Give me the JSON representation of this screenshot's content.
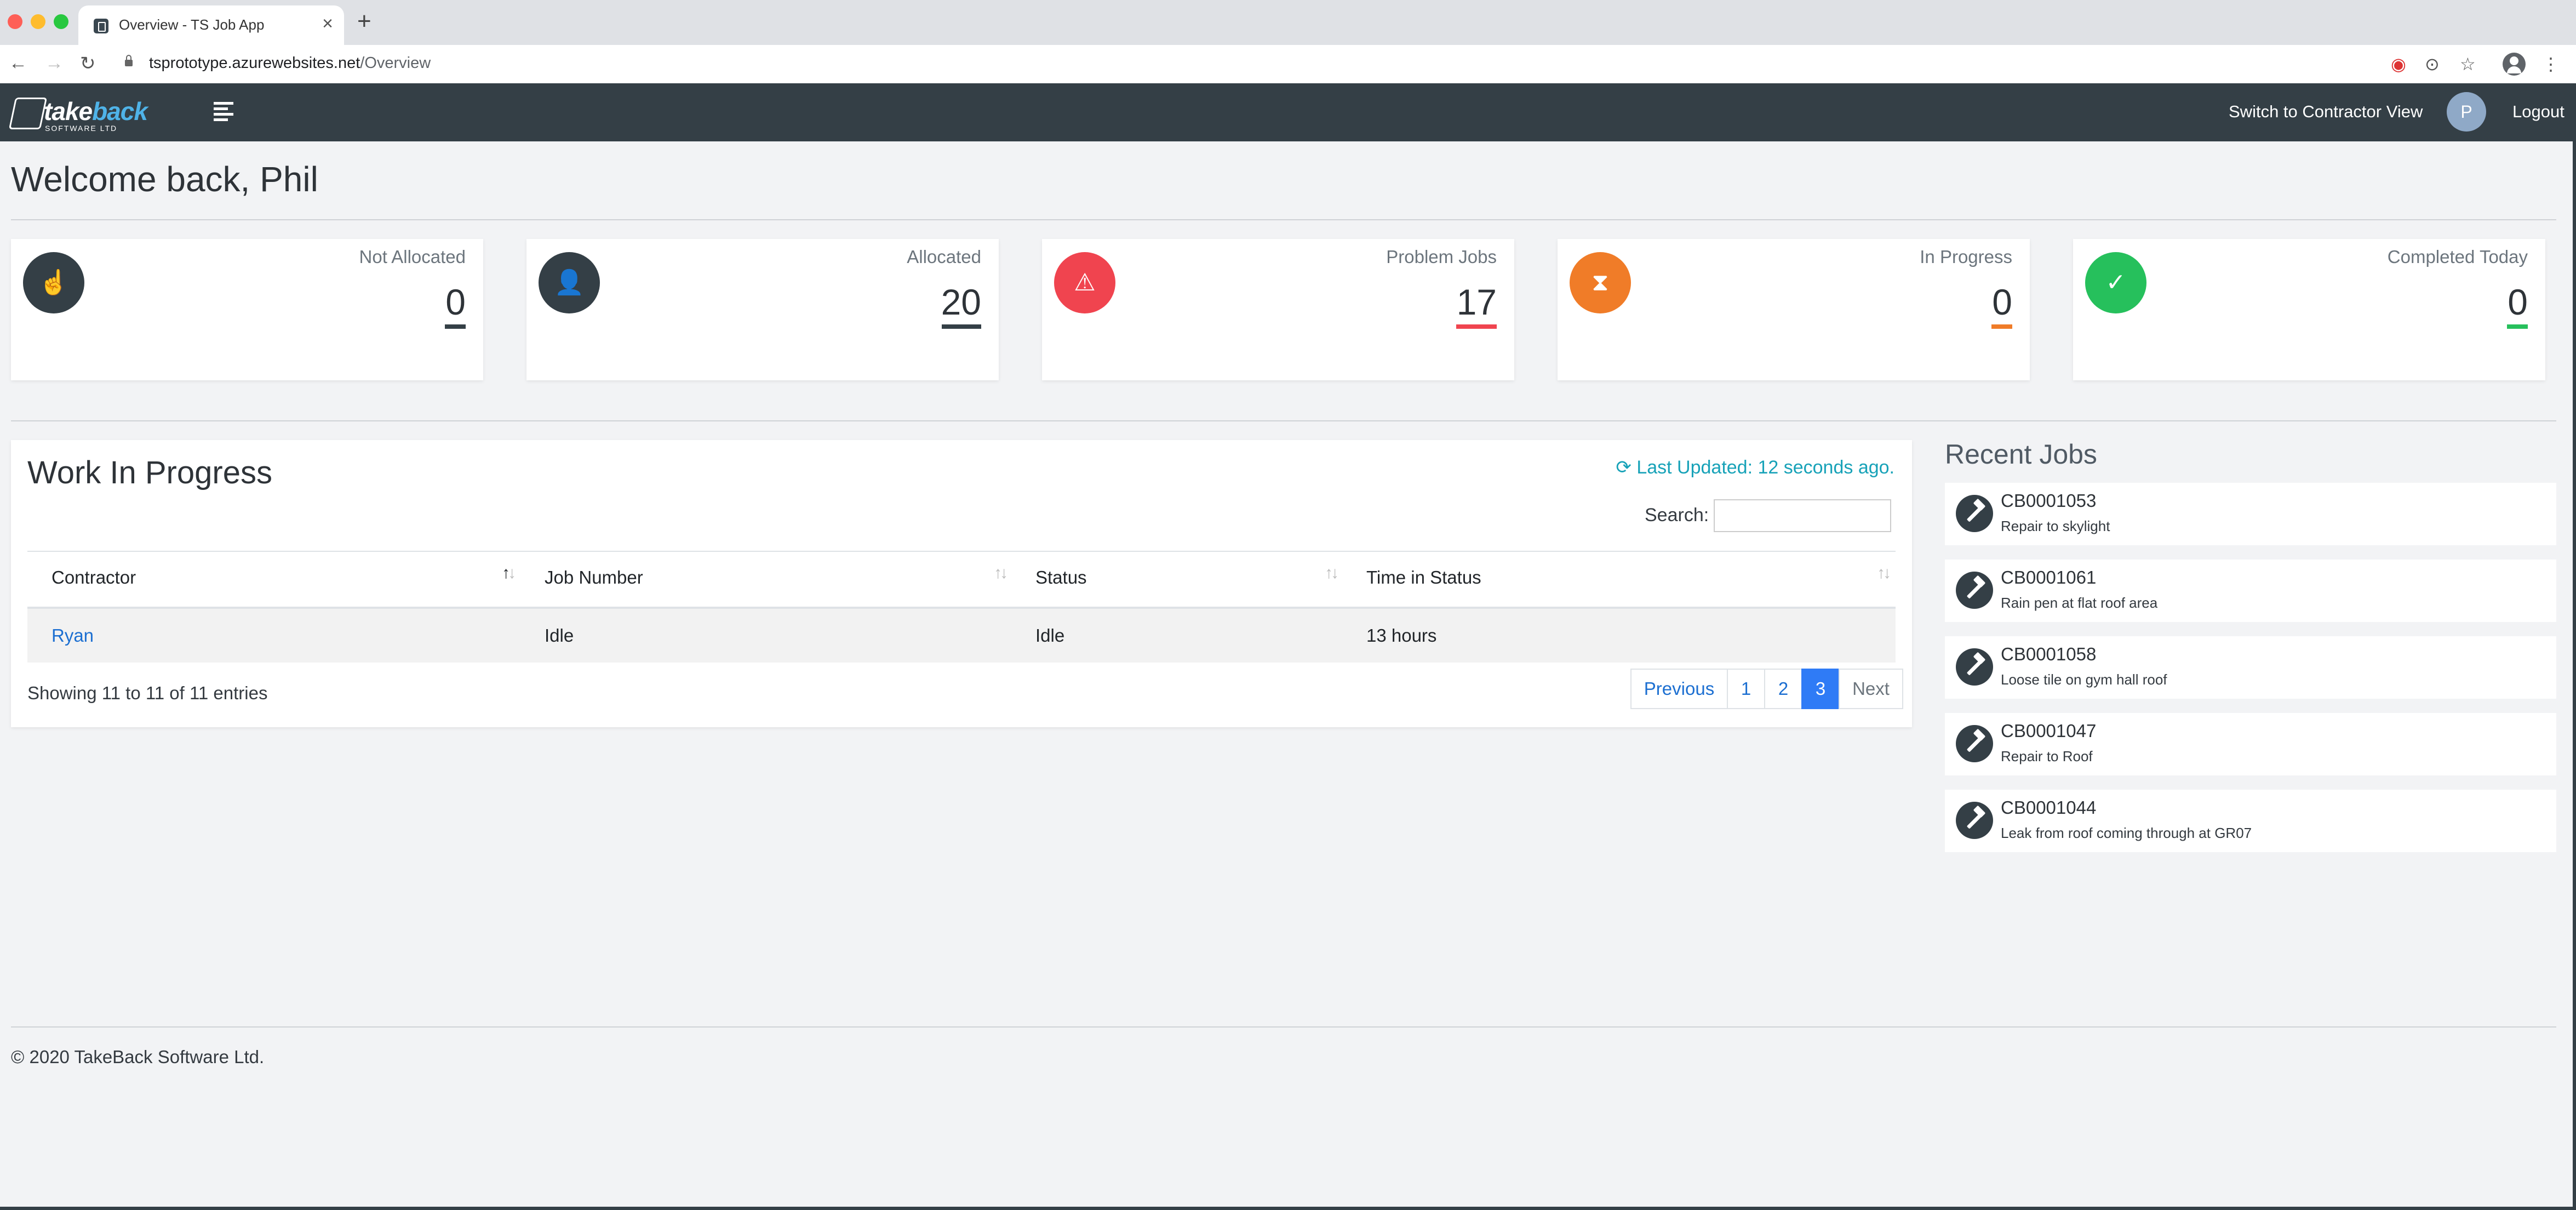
{
  "browser": {
    "tab_title": "Overview - TS Job App",
    "url_host": "tsprototype.azurewebsites.net",
    "url_path": "/Overview"
  },
  "navbar": {
    "logo_take": "take",
    "logo_back": "back",
    "logo_sub": "SOFTWARE LTD",
    "switch_label": "Switch to Contractor View",
    "avatar_initial": "P",
    "logout_label": "Logout"
  },
  "welcome": "Welcome back, Phil",
  "stats": [
    {
      "label": "Not Allocated",
      "value": "0",
      "icon": "hand-pointer-icon",
      "color": "#343f46"
    },
    {
      "label": "Allocated",
      "value": "20",
      "icon": "user-check-icon",
      "color": "#343f46"
    },
    {
      "label": "Problem Jobs",
      "value": "17",
      "icon": "warning-icon",
      "color": "#f0444f"
    },
    {
      "label": "In Progress",
      "value": "0",
      "icon": "hourglass-icon",
      "color": "#f07c28"
    },
    {
      "label": "Completed Today",
      "value": "0",
      "icon": "clipboard-check-icon",
      "color": "#26c05c"
    }
  ],
  "wip": {
    "title": "Work In Progress",
    "last_updated": "Last Updated: 12 seconds ago.",
    "search_label": "Search:",
    "columns": [
      "Contractor",
      "Job Number",
      "Status",
      "Time in Status"
    ],
    "rows": [
      {
        "contractor": "Ryan",
        "job_number": "Idle",
        "status": "Idle",
        "time": "13 hours"
      }
    ],
    "showing": "Showing 11 to 11 of 11 entries",
    "pagination": {
      "previous": "Previous",
      "pages": [
        "1",
        "2",
        "3"
      ],
      "active": "3",
      "next": "Next"
    }
  },
  "recent": {
    "title": "Recent Jobs",
    "jobs": [
      {
        "number": "CB0001053",
        "desc": "Repair to skylight"
      },
      {
        "number": "CB0001061",
        "desc": "Rain pen at flat roof area"
      },
      {
        "number": "CB0001058",
        "desc": "Loose tile on gym hall roof"
      },
      {
        "number": "CB0001047",
        "desc": "Repair to Roof"
      },
      {
        "number": "CB0001044",
        "desc": "Leak from roof coming through at GR07"
      }
    ]
  },
  "footer": "© 2020 TakeBack Software Ltd."
}
